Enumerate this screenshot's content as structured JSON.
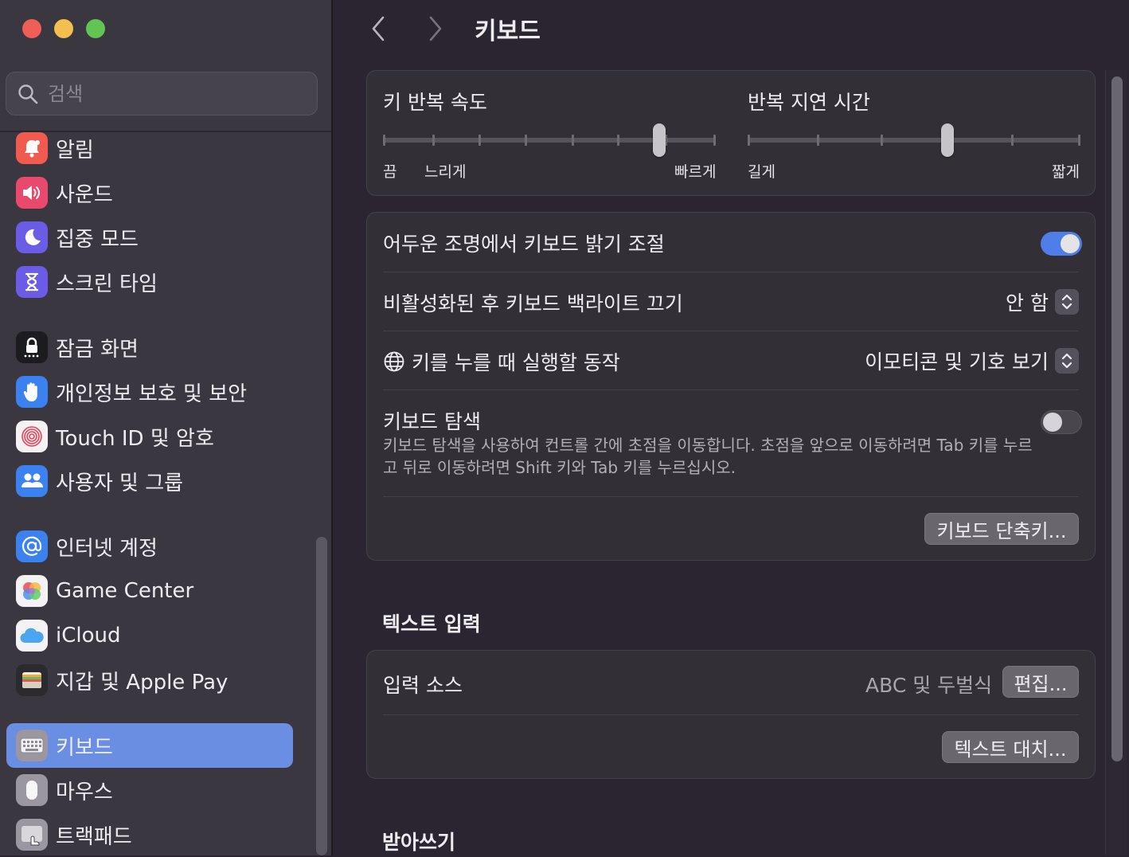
{
  "window": {
    "title": "키보드"
  },
  "sidebar": {
    "search": {
      "placeholder": "검색"
    },
    "items": [
      {
        "label": "알림",
        "icon": "bell-icon",
        "color": "#f05a4f"
      },
      {
        "label": "사운드",
        "icon": "speaker-icon",
        "color": "#e8496c"
      },
      {
        "label": "집중 모드",
        "icon": "moon-icon",
        "color": "#6a5ce6"
      },
      {
        "label": "스크린 타임",
        "icon": "hourglass-icon",
        "color": "#6a5ce6"
      },
      {
        "label": "잠금 화면",
        "icon": "lock-icon",
        "color": "#1c1b1f"
      },
      {
        "label": "개인정보 보호 및 보안",
        "icon": "hand-icon",
        "color": "#3b82f0"
      },
      {
        "label": "Touch ID 및 암호",
        "icon": "fingerprint-icon",
        "color": "#f4f2f5"
      },
      {
        "label": "사용자 및 그룹",
        "icon": "users-icon",
        "color": "#3b82f0"
      },
      {
        "label": "인터넷 계정",
        "icon": "at-icon",
        "color": "#3b82f0"
      },
      {
        "label": "Game Center",
        "icon": "game-center-icon",
        "color": "#f4f2f5"
      },
      {
        "label": "iCloud",
        "icon": "cloud-icon",
        "color": "#f4f2f5"
      },
      {
        "label": "지갑 및 Apple Pay",
        "icon": "wallet-icon",
        "color": "#2b2a2e"
      },
      {
        "label": "키보드",
        "icon": "keyboard-icon",
        "color": "#9a97a0",
        "selected": true
      },
      {
        "label": "마우스",
        "icon": "mouse-icon",
        "color": "#9a97a0"
      },
      {
        "label": "트랙패드",
        "icon": "trackpad-icon",
        "color": "#9a97a0"
      }
    ]
  },
  "main": {
    "key_repeat": {
      "title": "키 반복 속도",
      "label_off": "끔",
      "label_slow": "느리게",
      "label_fast": "빠르게",
      "value": 0.83
    },
    "repeat_delay": {
      "title": "반복 지연 시간",
      "label_long": "길게",
      "label_short": "짧게",
      "value": 0.6
    },
    "settings": {
      "brightness_label": "어두운 조명에서 키보드 밝기 조절",
      "brightness_on": true,
      "backlight_label": "비활성화된 후 키보드 백라이트 끄기",
      "backlight_value": "안 함",
      "globe_label": "키를 누를 때 실행할 동작",
      "globe_value": "이모티콘 및 기호 보기",
      "nav_label": "키보드 탐색",
      "nav_desc": "키보드 탐색을 사용하여 컨트롤 간에 초점을 이동합니다. 초점을 앞으로 이동하려면 Tab 키를 누르고 뒤로 이동하려면 Shift 키와 Tab 키를 누르십시오.",
      "nav_on": false,
      "shortcuts_button": "키보드 단축키..."
    },
    "text_input": {
      "heading": "텍스트 입력",
      "source_label": "입력 소스",
      "source_value": "ABC 및 두벌식",
      "edit_button": "편집...",
      "replace_button": "텍스트 대치..."
    },
    "dictation": {
      "heading": "받아쓰기"
    }
  },
  "colors": {
    "accent": "#4f7ee8",
    "selection": "#6a8fe2"
  }
}
